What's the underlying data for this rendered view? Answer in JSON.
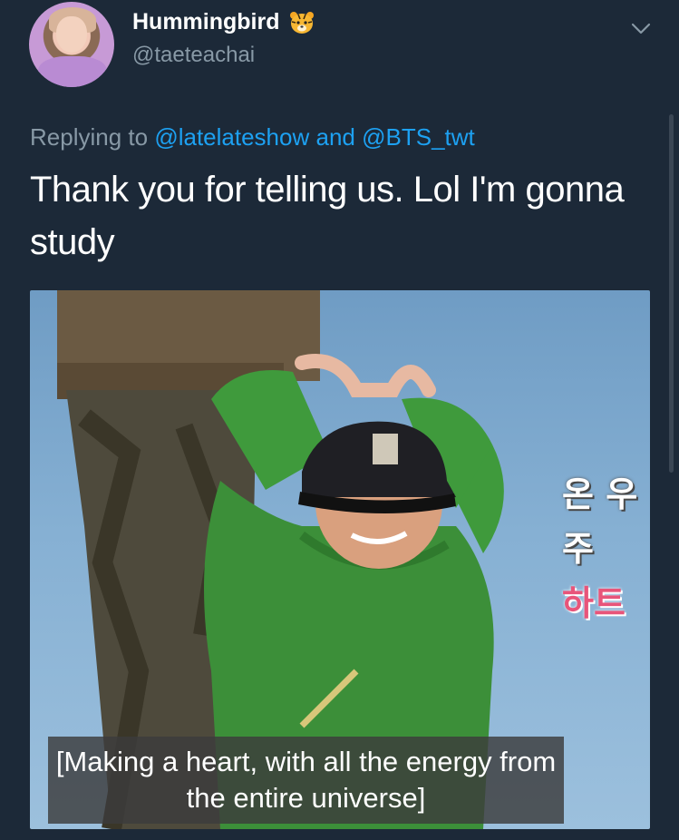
{
  "tweet": {
    "display_name": "Hummingbird",
    "name_emoji": "tiger-face-icon",
    "username": "@taeteachai",
    "reply_prefix": "Replying to",
    "reply_mention_1": "@latelateshow",
    "reply_joiner": "and",
    "reply_mention_2": "@BTS_twt",
    "text": "Thank you for telling us. Lol I'm gonna study"
  },
  "media": {
    "caption": "[Making a heart, with all the energy from the entire universe]",
    "korean_line_1": "온 우주",
    "korean_line_2": "하트"
  },
  "colors": {
    "background": "#1c2938",
    "secondary_text": "#8899a6",
    "link": "#1da1f2",
    "korean_pink": "#e8557a"
  }
}
